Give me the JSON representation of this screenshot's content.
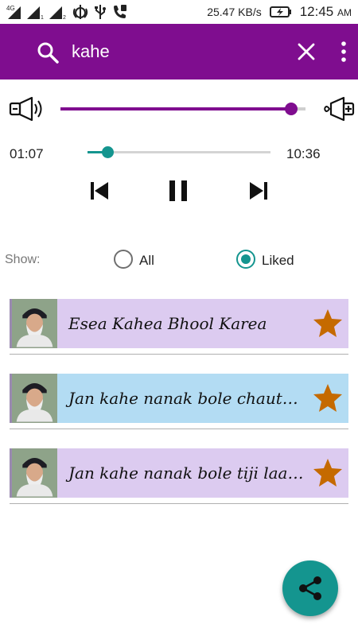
{
  "status_bar": {
    "network": "4G",
    "sim1": "1",
    "sim2": "2",
    "speed": "25.47 KB/s",
    "time": "12:45",
    "ampm": "AM",
    "icons": [
      "signal-icon",
      "khanda-icon",
      "usb-icon",
      "phone-icon",
      "battery-charging-icon"
    ]
  },
  "search": {
    "value": "kahe",
    "placeholder": ""
  },
  "player": {
    "volume_fraction": 0.94,
    "elapsed": "01:07",
    "total": "10:36",
    "progress_fraction": 0.107
  },
  "filter": {
    "show_label": "Show:",
    "options": [
      {
        "label": "All",
        "selected": false
      },
      {
        "label": "Liked",
        "selected": true
      }
    ]
  },
  "tracks": [
    {
      "title": "Esea Kahea Bhool Karea",
      "bg": "#dccbf0",
      "liked": true
    },
    {
      "title": "Jan kahe nanak bole chauthi la...",
      "bg": "#b3dcf3",
      "liked": true
    },
    {
      "title": "Jan kahe nanak bole tiji laang J...",
      "bg": "#dccbf0",
      "liked": true
    }
  ],
  "colors": {
    "primary": "#7f0d8f",
    "accent": "#14958f",
    "star": "#c56a00"
  }
}
